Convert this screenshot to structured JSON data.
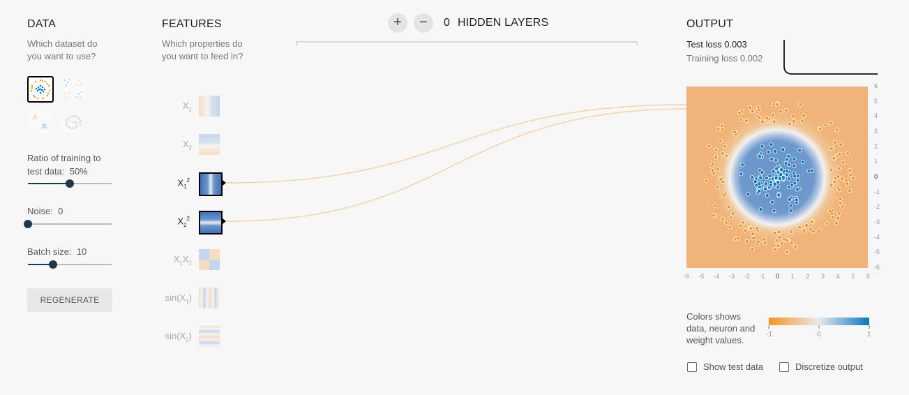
{
  "data_panel": {
    "heading": "DATA",
    "subtitle_line1": "Which dataset do",
    "subtitle_line2": "you want to use?",
    "datasets": [
      {
        "name": "circle",
        "selected": true
      },
      {
        "name": "exclusive-or",
        "selected": false
      },
      {
        "name": "gaussian",
        "selected": false
      },
      {
        "name": "spiral",
        "selected": false
      }
    ],
    "ratio_label_line1": "Ratio of training to",
    "ratio_label_line2": "test data:",
    "ratio_value": "50%",
    "ratio_fraction": 0.5,
    "noise_label": "Noise:",
    "noise_value": "0",
    "noise_fraction": 0.0,
    "batch_label": "Batch size:",
    "batch_value": "10",
    "batch_fraction": 0.3,
    "regenerate_label": "REGENERATE"
  },
  "features_panel": {
    "heading": "FEATURES",
    "subtitle_line1": "Which properties do",
    "subtitle_line2": "you want to feed in?",
    "features": [
      {
        "base": "X",
        "sub": "1",
        "sup": "",
        "active": false
      },
      {
        "base": "X",
        "sub": "2",
        "sup": "",
        "active": false
      },
      {
        "base": "X",
        "sub": "1",
        "sup": "2",
        "active": true
      },
      {
        "base": "X",
        "sub": "2",
        "sup": "2",
        "active": true
      },
      {
        "base": "X",
        "sub": "1",
        "base2": "X",
        "sub2": "2",
        "active": false
      },
      {
        "base": "sin(X",
        "sub": "1",
        "tail": ")",
        "active": false
      },
      {
        "base": "sin(X",
        "sub": "2",
        "tail": ")",
        "active": false
      }
    ]
  },
  "hidden_layers": {
    "plus_symbol": "+",
    "minus_symbol": "−",
    "count": "0",
    "label": "HIDDEN LAYERS"
  },
  "output_panel": {
    "heading": "OUTPUT",
    "test_loss_label": "Test loss",
    "test_loss_value": "0.003",
    "training_loss_label": "Training loss",
    "training_loss_value": "0.002",
    "axis_ticks": [
      "-6",
      "-5",
      "-4",
      "-3",
      "-2",
      "-1",
      "0",
      "1",
      "2",
      "3",
      "4",
      "5",
      "6"
    ],
    "y_ticks": [
      "6",
      "5",
      "4",
      "3",
      "2",
      "1",
      "0",
      "-1",
      "-2",
      "-3",
      "-4",
      "-5",
      "-6"
    ],
    "legend_line1": "Colors shows",
    "legend_line2": "data, neuron and",
    "legend_line3": "weight values.",
    "legend_min": "-1",
    "legend_mid": "0",
    "legend_max": "1",
    "show_test_data_label": "Show test data",
    "discretize_label": "Discretize output",
    "colors": {
      "orange": "#f59322",
      "blue": "#0877bd",
      "bg_orange": "#f0b47a"
    }
  }
}
